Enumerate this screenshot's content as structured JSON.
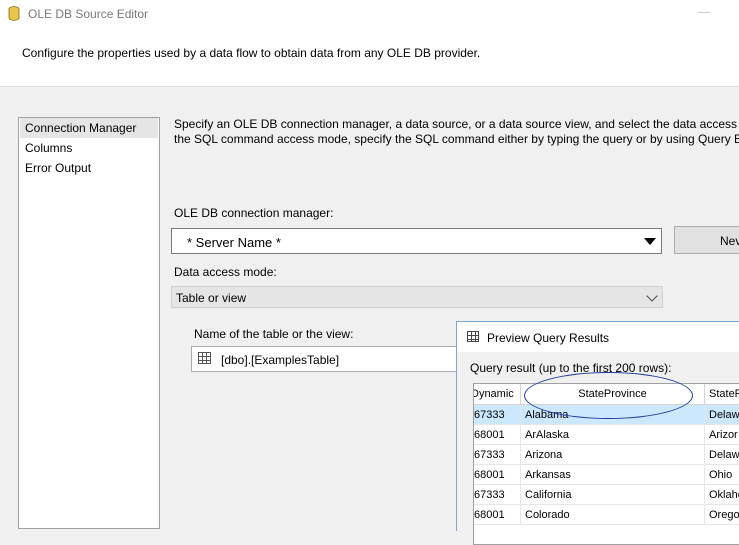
{
  "window": {
    "title": "OLE DB Source Editor"
  },
  "header": {
    "description": "Configure the properties used by a data flow to obtain data from any OLE DB provider."
  },
  "nav": {
    "items": [
      "Connection Manager",
      "Columns",
      "Error Output"
    ]
  },
  "main": {
    "info_line1": "Specify an OLE DB connection manager, a data source, or a data source view, and select the data access mo",
    "info_line2": "the SQL command access mode, specify the SQL command either by typing the query or by using Query Bu",
    "connection_label": "OLE DB connection manager:",
    "connection_value": "* Server Name *",
    "new_button": "Nev",
    "access_mode_label": "Data access mode:",
    "access_mode_value": "Table or view",
    "table_label": "Name of the table or the view:",
    "table_value": "[dbo].[ExamplesTable]"
  },
  "preview": {
    "title": "Preview Query Results",
    "caption": "Query result (up to the first 200 rows):",
    "columns": [
      "Dynamic",
      "StateProvince",
      "StateP"
    ],
    "rows": [
      [
        "67333",
        "Alabama",
        "Delaw"
      ],
      [
        "68001",
        "ArAlaska",
        "Arizor"
      ],
      [
        "67333",
        "Arizona",
        "Delaw"
      ],
      [
        "68001",
        "Arkansas",
        "Ohio"
      ],
      [
        "67333",
        "California",
        "Oklaho"
      ],
      [
        "68001",
        "Colorado",
        "Orego"
      ]
    ]
  },
  "colors": {
    "selection": "#cce8ff",
    "annotation": "#1f3b9a"
  }
}
